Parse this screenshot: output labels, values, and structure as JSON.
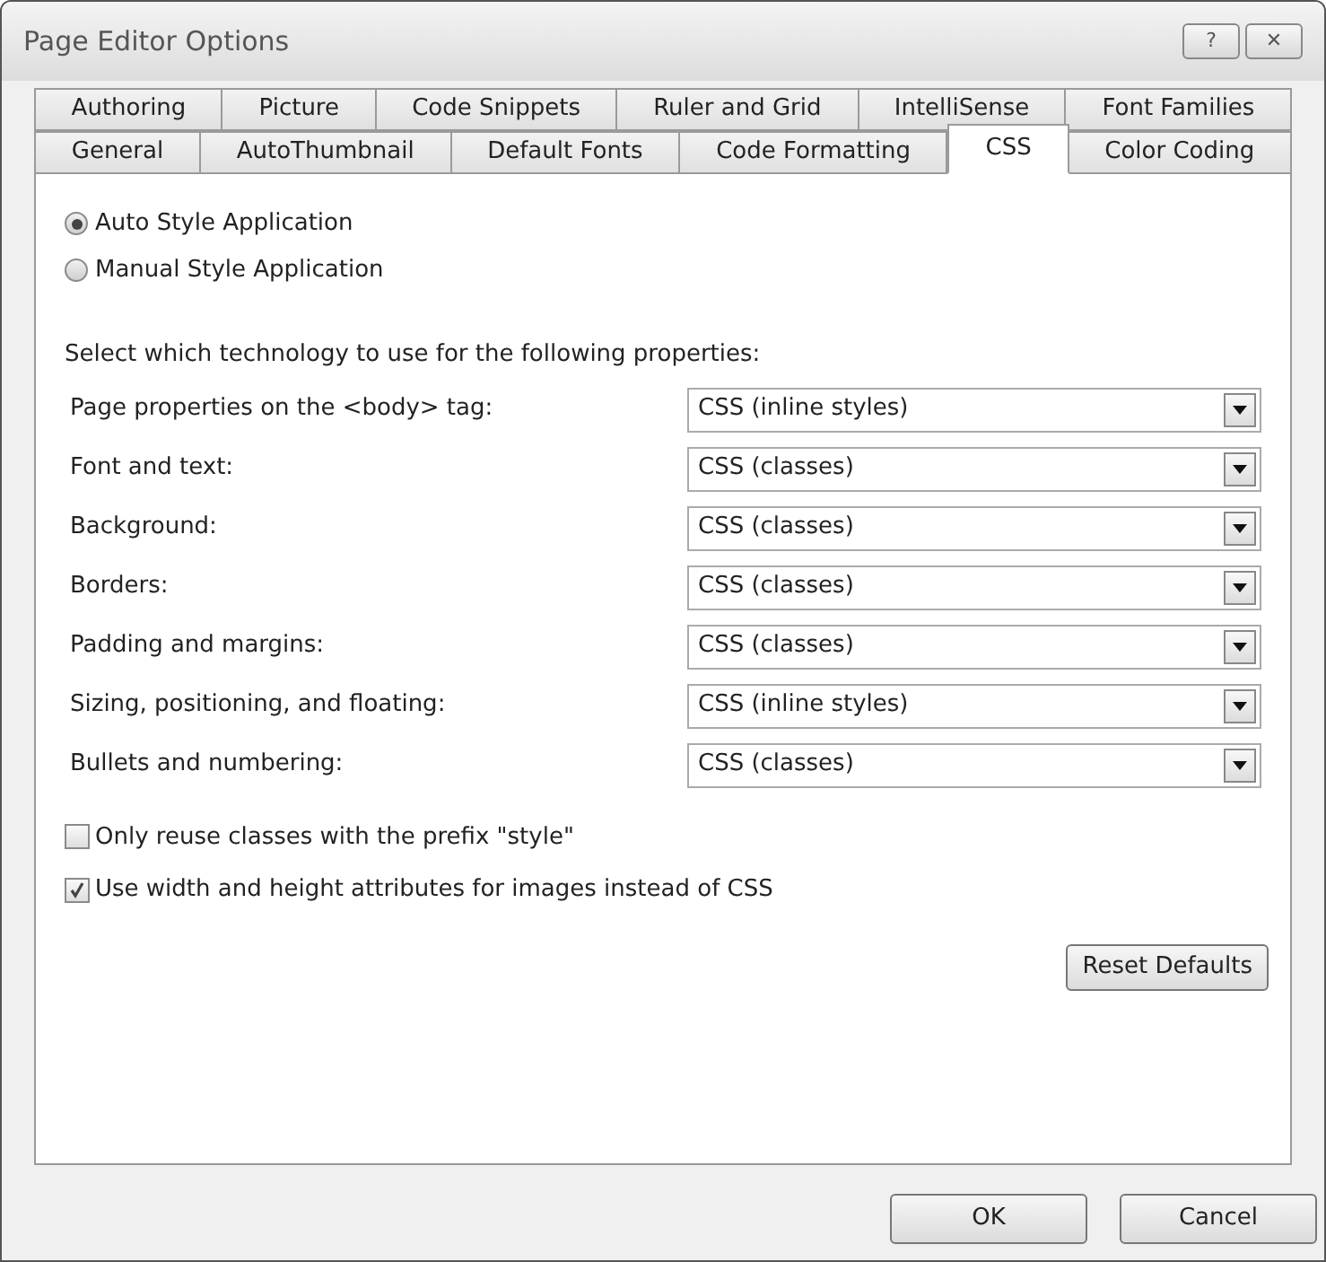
{
  "window": {
    "title": "Page Editor Options",
    "buttons": [
      "?",
      "✕"
    ]
  },
  "tab_rows": [
    [
      {
        "label": "Authoring",
        "selected": false
      },
      {
        "label": "Picture",
        "selected": false
      },
      {
        "label": "Code Snippets",
        "selected": false
      },
      {
        "label": "Ruler and Grid",
        "selected": false
      },
      {
        "label": "IntelliSense",
        "selected": false
      },
      {
        "label": "Font Families",
        "selected": false
      }
    ],
    [
      {
        "label": "General",
        "selected": false
      },
      {
        "label": "AutoThumbnail",
        "selected": false
      },
      {
        "label": "Default Fonts",
        "selected": false
      },
      {
        "label": "Code Formatting",
        "selected": false
      },
      {
        "label": "CSS",
        "selected": true
      },
      {
        "label": "Color Coding",
        "selected": false
      }
    ]
  ],
  "style_mode": [
    {
      "label": "Auto Style Application",
      "selected": true
    },
    {
      "label": "Manual Style Application",
      "selected": false
    }
  ],
  "technology_heading": "Select which technology to use for the following properties:",
  "properties": [
    {
      "label": "Page properties on the <body> tag:",
      "value": "CSS (inline styles)"
    },
    {
      "label": "Font and text:",
      "value": "CSS (classes)"
    },
    {
      "label": "Background:",
      "value": "CSS (classes)"
    },
    {
      "label": "Borders:",
      "value": "CSS (classes)"
    },
    {
      "label": "Padding and margins:",
      "value": "CSS (classes)"
    },
    {
      "label": "Sizing, positioning, and floating:",
      "value": "CSS (inline styles)"
    },
    {
      "label": "Bullets and numbering:",
      "value": "CSS (classes)"
    }
  ],
  "options": [
    {
      "label": "Only reuse classes with the prefix \"style\"",
      "checked": false
    },
    {
      "label": "Use width and height attributes for images instead of CSS",
      "checked": true
    }
  ],
  "reset_button": "Reset Defaults",
  "footer_buttons": [
    "OK",
    "Cancel"
  ]
}
